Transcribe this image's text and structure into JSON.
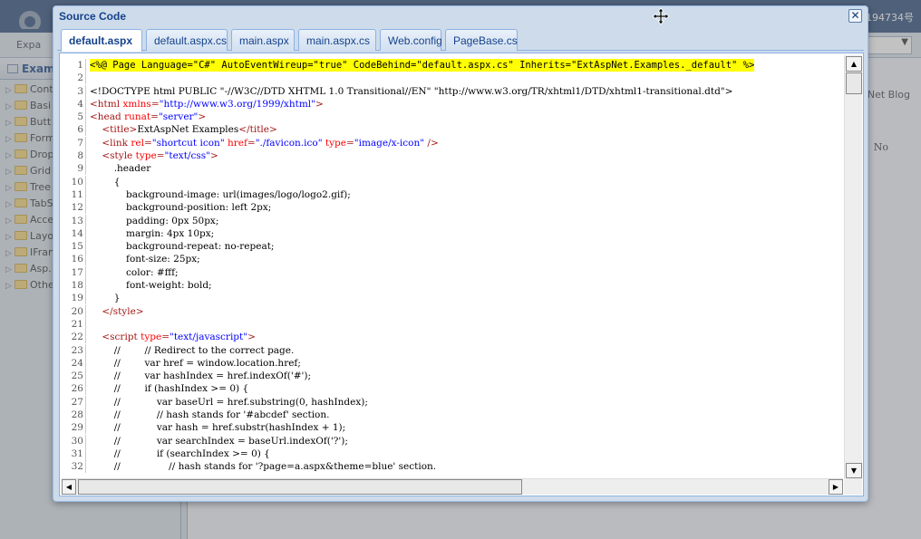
{
  "background": {
    "header_text": "194734号",
    "toolbar_button": "Expa",
    "left_title": "Exam",
    "tree_items": [
      "Cont",
      "Basi",
      "Butt",
      "Form",
      "Drop",
      "Grid",
      "Tree",
      "TabS",
      "Acce",
      "Layo",
      "IFran",
      "Asp.",
      "Othe"
    ],
    "blog_text": "pNet Blog",
    "no_text": "No"
  },
  "window": {
    "title": "Source Code",
    "close_glyph": "✕",
    "tabs": [
      {
        "label": "default.aspx",
        "active": true
      },
      {
        "label": "default.aspx.cs",
        "active": false
      },
      {
        "label": "main.aspx",
        "active": false
      },
      {
        "label": "main.aspx.cs",
        "active": false
      },
      {
        "label": "Web.config",
        "active": false
      },
      {
        "label": "PageBase.cs",
        "active": false
      }
    ]
  },
  "code": {
    "lines": [
      {
        "n": "1",
        "hl": true,
        "mono": true,
        "parts": [
          [
            "plain",
            "<%@ Page Language=\"C#\" AutoEventWireup=\"true\" CodeBehind=\"default.aspx.cs\" Inherits=\"ExtAspNet.Examples._default\" %>"
          ]
        ]
      },
      {
        "n": "2",
        "parts": []
      },
      {
        "n": "3",
        "parts": [
          [
            "plain",
            "<!DOCTYPE html PUBLIC \"-//W3C//DTD XHTML 1.0 Transitional//EN\" \"http://www.w3.org/TR/xhtml1/DTD/xhtml1-transitional.dtd\">"
          ]
        ]
      },
      {
        "n": "4",
        "parts": [
          [
            "tag",
            "<html "
          ],
          [
            "attr",
            "xmlns"
          ],
          [
            "tag",
            "="
          ],
          [
            "val",
            "\"http://www.w3.org/1999/xhtml\""
          ],
          [
            "tag",
            ">"
          ]
        ]
      },
      {
        "n": "5",
        "parts": [
          [
            "tag",
            "<head "
          ],
          [
            "attr",
            "runat"
          ],
          [
            "tag",
            "="
          ],
          [
            "val",
            "\"server\""
          ],
          [
            "tag",
            ">"
          ]
        ]
      },
      {
        "n": "6",
        "parts": [
          [
            "plain",
            "    "
          ],
          [
            "tag",
            "<title>"
          ],
          [
            "plain",
            "ExtAspNet Examples"
          ],
          [
            "tag",
            "</title>"
          ]
        ]
      },
      {
        "n": "7",
        "parts": [
          [
            "plain",
            "    "
          ],
          [
            "tag",
            "<link "
          ],
          [
            "attr",
            "rel"
          ],
          [
            "tag",
            "="
          ],
          [
            "val",
            "\"shortcut icon\" "
          ],
          [
            "attr",
            "href"
          ],
          [
            "tag",
            "="
          ],
          [
            "val",
            "\"./favicon.ico\" "
          ],
          [
            "attr",
            "type"
          ],
          [
            "tag",
            "="
          ],
          [
            "val",
            "\"image/x-icon\" "
          ],
          [
            "tag",
            "/>"
          ]
        ]
      },
      {
        "n": "8",
        "parts": [
          [
            "plain",
            "    "
          ],
          [
            "tag",
            "<style "
          ],
          [
            "attr",
            "type"
          ],
          [
            "tag",
            "="
          ],
          [
            "val",
            "\"text/css\""
          ],
          [
            "tag",
            ">"
          ]
        ]
      },
      {
        "n": "9",
        "parts": [
          [
            "plain",
            "        .header"
          ]
        ]
      },
      {
        "n": "10",
        "parts": [
          [
            "plain",
            "        {"
          ]
        ]
      },
      {
        "n": "11",
        "parts": [
          [
            "plain",
            "            background-image: url(images/logo/logo2.gif);"
          ]
        ]
      },
      {
        "n": "12",
        "parts": [
          [
            "plain",
            "            background-position: left 2px;"
          ]
        ]
      },
      {
        "n": "13",
        "parts": [
          [
            "plain",
            "            padding: 0px 50px;"
          ]
        ]
      },
      {
        "n": "14",
        "parts": [
          [
            "plain",
            "            margin: 4px 10px;"
          ]
        ]
      },
      {
        "n": "15",
        "parts": [
          [
            "plain",
            "            background-repeat: no-repeat;"
          ]
        ]
      },
      {
        "n": "16",
        "parts": [
          [
            "plain",
            "            font-size: 25px;"
          ]
        ]
      },
      {
        "n": "17",
        "parts": [
          [
            "plain",
            "            color: #fff;"
          ]
        ]
      },
      {
        "n": "18",
        "parts": [
          [
            "plain",
            "            font-weight: bold;"
          ]
        ]
      },
      {
        "n": "19",
        "parts": [
          [
            "plain",
            "        }"
          ]
        ]
      },
      {
        "n": "20",
        "parts": [
          [
            "plain",
            "    "
          ],
          [
            "tag",
            "</style>"
          ]
        ]
      },
      {
        "n": "21",
        "parts": []
      },
      {
        "n": "22",
        "parts": [
          [
            "plain",
            "    "
          ],
          [
            "tag",
            "<script "
          ],
          [
            "attr",
            "type"
          ],
          [
            "tag",
            "="
          ],
          [
            "val",
            "\"text/javascript\""
          ],
          [
            "tag",
            ">"
          ]
        ]
      },
      {
        "n": "23",
        "parts": [
          [
            "plain",
            "        //        // Redirect to the correct page."
          ]
        ]
      },
      {
        "n": "24",
        "parts": [
          [
            "plain",
            "        //        var href = window.location.href;"
          ]
        ]
      },
      {
        "n": "25",
        "parts": [
          [
            "plain",
            "        //        var hashIndex = href.indexOf('#');"
          ]
        ]
      },
      {
        "n": "26",
        "parts": [
          [
            "plain",
            "        //        if (hashIndex >= 0) {"
          ]
        ]
      },
      {
        "n": "27",
        "parts": [
          [
            "plain",
            "        //            var baseUrl = href.substring(0, hashIndex);"
          ]
        ]
      },
      {
        "n": "28",
        "parts": [
          [
            "plain",
            "        //            // hash stands for '#abcdef' section."
          ]
        ]
      },
      {
        "n": "29",
        "parts": [
          [
            "plain",
            "        //            var hash = href.substr(hashIndex + 1);"
          ]
        ]
      },
      {
        "n": "30",
        "parts": [
          [
            "plain",
            "        //            var searchIndex = baseUrl.indexOf('?');"
          ]
        ]
      },
      {
        "n": "31",
        "parts": [
          [
            "plain",
            "        //            if (searchIndex >= 0) {"
          ]
        ]
      },
      {
        "n": "32",
        "parts": [
          [
            "plain",
            "        //                // hash stands for '?page=a.aspx&theme=blue' section."
          ]
        ]
      }
    ]
  },
  "scrollbars": {
    "up_glyph": "▲",
    "down_glyph": "▼",
    "left_glyph": "◀",
    "right_glyph": "▶"
  }
}
